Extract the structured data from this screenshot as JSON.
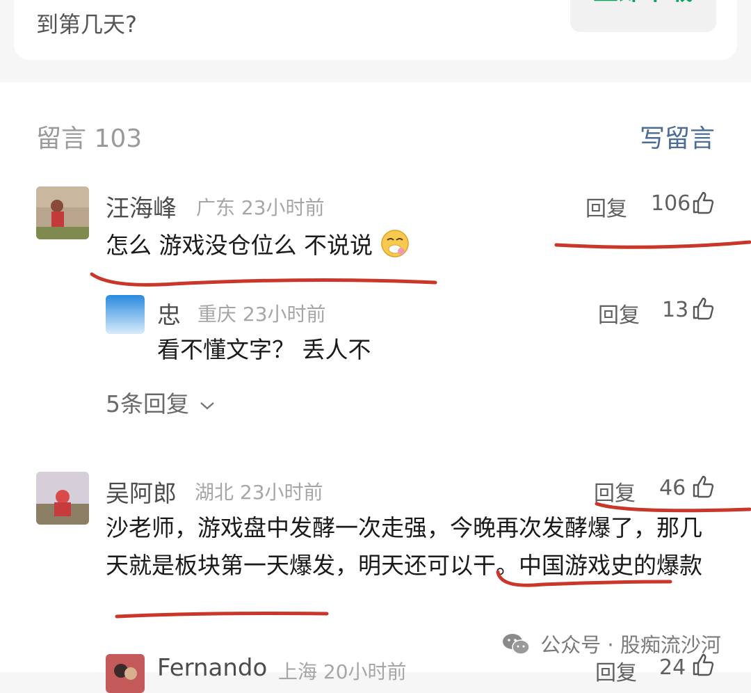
{
  "top_card": {
    "text": "到第几天?",
    "download_label": "立即下载"
  },
  "comments_header": {
    "count_label": "留言 103",
    "write_label": "写留言"
  },
  "comments": [
    {
      "name": "汪海峰",
      "meta": "广东 23小时前",
      "reply_label": "回复",
      "likes": "106",
      "content": "怎么 游戏没仓位么 不说说",
      "emoji": "emoji-face",
      "sub_reply": {
        "name": "忠",
        "meta": "重庆 23小时前",
        "reply_label": "回复",
        "likes": "13",
        "content": "看不懂文字？ 丢人不"
      },
      "more_replies": "5条回复"
    },
    {
      "name": "吴阿郎",
      "meta": "湖北 23小时前",
      "reply_label": "回复",
      "likes": "46",
      "content": "沙老师，游戏盘中发酵一次走强，今晚再次发酵爆了，那几天就是板块第一天爆发，明天还可以干。中国游戏史的爆款"
    },
    {
      "name": "Fernando",
      "meta": "上海 20小时前",
      "reply_label": "回复",
      "likes": "24"
    }
  ],
  "watermark": "公众号 · 股痴流沙河",
  "colors": {
    "accent_link": "#4b6c99",
    "download_green": "#07a35a",
    "annotation_red": "#c8372a"
  }
}
